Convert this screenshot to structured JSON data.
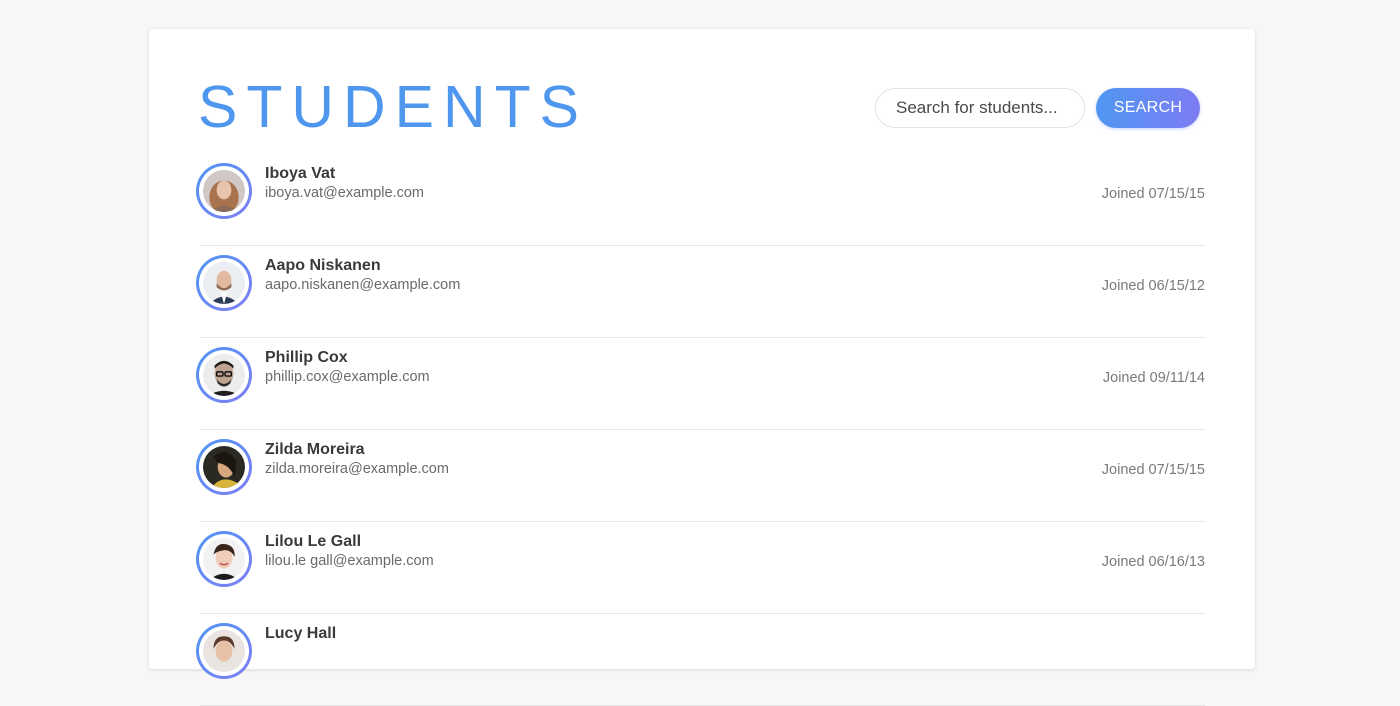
{
  "header": {
    "title": "STUDENTS"
  },
  "search": {
    "placeholder": "Search for students...",
    "button_label": "SEARCH"
  },
  "colors": {
    "accent_start": "#4f97f3",
    "accent_end": "#7e7cf3",
    "title": "#4f97ee"
  },
  "students": [
    {
      "name": "Iboya Vat",
      "email": "iboya.vat@example.com",
      "joined": "Joined 07/15/15",
      "avatar": "portrait-photo"
    },
    {
      "name": "Aapo Niskanen",
      "email": "aapo.niskanen@example.com",
      "joined": "Joined 06/15/12",
      "avatar": "portrait-photo"
    },
    {
      "name": "Phillip Cox",
      "email": "phillip.cox@example.com",
      "joined": "Joined 09/11/14",
      "avatar": "portrait-photo"
    },
    {
      "name": "Zilda Moreira",
      "email": "zilda.moreira@example.com",
      "joined": "Joined 07/15/15",
      "avatar": "portrait-photo"
    },
    {
      "name": "Lilou Le Gall",
      "email": "lilou.le gall@example.com",
      "joined": "Joined 06/16/13",
      "avatar": "portrait-photo"
    },
    {
      "name": "Lucy Hall",
      "email": "",
      "joined": "",
      "avatar": "portrait-photo"
    }
  ]
}
